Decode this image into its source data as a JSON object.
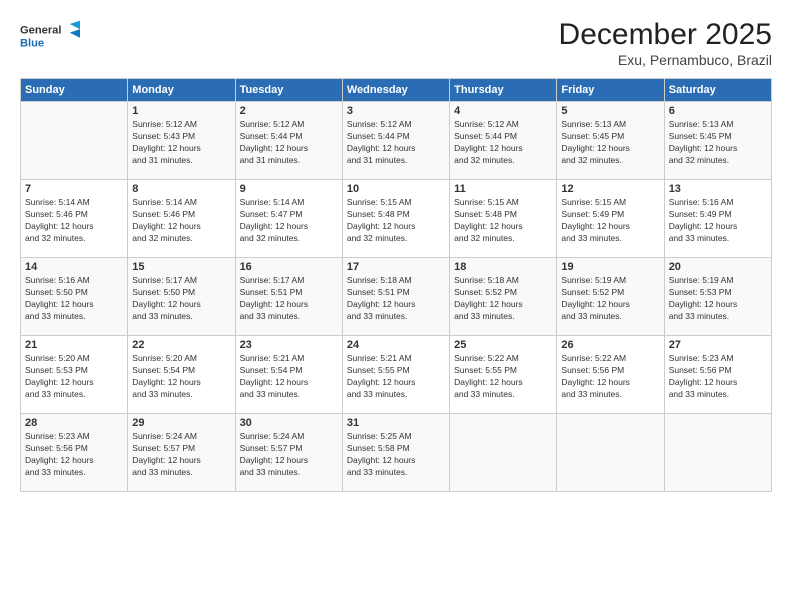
{
  "logo": {
    "line1": "General",
    "line2": "Blue"
  },
  "title": "December 2025",
  "subtitle": "Exu, Pernambuco, Brazil",
  "days": [
    "Sunday",
    "Monday",
    "Tuesday",
    "Wednesday",
    "Thursday",
    "Friday",
    "Saturday"
  ],
  "weeks": [
    [
      {
        "day": "",
        "text": ""
      },
      {
        "day": "1",
        "text": "Sunrise: 5:12 AM\nSunset: 5:43 PM\nDaylight: 12 hours\nand 31 minutes."
      },
      {
        "day": "2",
        "text": "Sunrise: 5:12 AM\nSunset: 5:44 PM\nDaylight: 12 hours\nand 31 minutes."
      },
      {
        "day": "3",
        "text": "Sunrise: 5:12 AM\nSunset: 5:44 PM\nDaylight: 12 hours\nand 31 minutes."
      },
      {
        "day": "4",
        "text": "Sunrise: 5:12 AM\nSunset: 5:44 PM\nDaylight: 12 hours\nand 32 minutes."
      },
      {
        "day": "5",
        "text": "Sunrise: 5:13 AM\nSunset: 5:45 PM\nDaylight: 12 hours\nand 32 minutes."
      },
      {
        "day": "6",
        "text": "Sunrise: 5:13 AM\nSunset: 5:45 PM\nDaylight: 12 hours\nand 32 minutes."
      }
    ],
    [
      {
        "day": "7",
        "text": "Sunrise: 5:14 AM\nSunset: 5:46 PM\nDaylight: 12 hours\nand 32 minutes."
      },
      {
        "day": "8",
        "text": "Sunrise: 5:14 AM\nSunset: 5:46 PM\nDaylight: 12 hours\nand 32 minutes."
      },
      {
        "day": "9",
        "text": "Sunrise: 5:14 AM\nSunset: 5:47 PM\nDaylight: 12 hours\nand 32 minutes."
      },
      {
        "day": "10",
        "text": "Sunrise: 5:15 AM\nSunset: 5:48 PM\nDaylight: 12 hours\nand 32 minutes."
      },
      {
        "day": "11",
        "text": "Sunrise: 5:15 AM\nSunset: 5:48 PM\nDaylight: 12 hours\nand 32 minutes."
      },
      {
        "day": "12",
        "text": "Sunrise: 5:15 AM\nSunset: 5:49 PM\nDaylight: 12 hours\nand 33 minutes."
      },
      {
        "day": "13",
        "text": "Sunrise: 5:16 AM\nSunset: 5:49 PM\nDaylight: 12 hours\nand 33 minutes."
      }
    ],
    [
      {
        "day": "14",
        "text": "Sunrise: 5:16 AM\nSunset: 5:50 PM\nDaylight: 12 hours\nand 33 minutes."
      },
      {
        "day": "15",
        "text": "Sunrise: 5:17 AM\nSunset: 5:50 PM\nDaylight: 12 hours\nand 33 minutes."
      },
      {
        "day": "16",
        "text": "Sunrise: 5:17 AM\nSunset: 5:51 PM\nDaylight: 12 hours\nand 33 minutes."
      },
      {
        "day": "17",
        "text": "Sunrise: 5:18 AM\nSunset: 5:51 PM\nDaylight: 12 hours\nand 33 minutes."
      },
      {
        "day": "18",
        "text": "Sunrise: 5:18 AM\nSunset: 5:52 PM\nDaylight: 12 hours\nand 33 minutes."
      },
      {
        "day": "19",
        "text": "Sunrise: 5:19 AM\nSunset: 5:52 PM\nDaylight: 12 hours\nand 33 minutes."
      },
      {
        "day": "20",
        "text": "Sunrise: 5:19 AM\nSunset: 5:53 PM\nDaylight: 12 hours\nand 33 minutes."
      }
    ],
    [
      {
        "day": "21",
        "text": "Sunrise: 5:20 AM\nSunset: 5:53 PM\nDaylight: 12 hours\nand 33 minutes."
      },
      {
        "day": "22",
        "text": "Sunrise: 5:20 AM\nSunset: 5:54 PM\nDaylight: 12 hours\nand 33 minutes."
      },
      {
        "day": "23",
        "text": "Sunrise: 5:21 AM\nSunset: 5:54 PM\nDaylight: 12 hours\nand 33 minutes."
      },
      {
        "day": "24",
        "text": "Sunrise: 5:21 AM\nSunset: 5:55 PM\nDaylight: 12 hours\nand 33 minutes."
      },
      {
        "day": "25",
        "text": "Sunrise: 5:22 AM\nSunset: 5:55 PM\nDaylight: 12 hours\nand 33 minutes."
      },
      {
        "day": "26",
        "text": "Sunrise: 5:22 AM\nSunset: 5:56 PM\nDaylight: 12 hours\nand 33 minutes."
      },
      {
        "day": "27",
        "text": "Sunrise: 5:23 AM\nSunset: 5:56 PM\nDaylight: 12 hours\nand 33 minutes."
      }
    ],
    [
      {
        "day": "28",
        "text": "Sunrise: 5:23 AM\nSunset: 5:56 PM\nDaylight: 12 hours\nand 33 minutes."
      },
      {
        "day": "29",
        "text": "Sunrise: 5:24 AM\nSunset: 5:57 PM\nDaylight: 12 hours\nand 33 minutes."
      },
      {
        "day": "30",
        "text": "Sunrise: 5:24 AM\nSunset: 5:57 PM\nDaylight: 12 hours\nand 33 minutes."
      },
      {
        "day": "31",
        "text": "Sunrise: 5:25 AM\nSunset: 5:58 PM\nDaylight: 12 hours\nand 33 minutes."
      },
      {
        "day": "",
        "text": ""
      },
      {
        "day": "",
        "text": ""
      },
      {
        "day": "",
        "text": ""
      }
    ]
  ]
}
